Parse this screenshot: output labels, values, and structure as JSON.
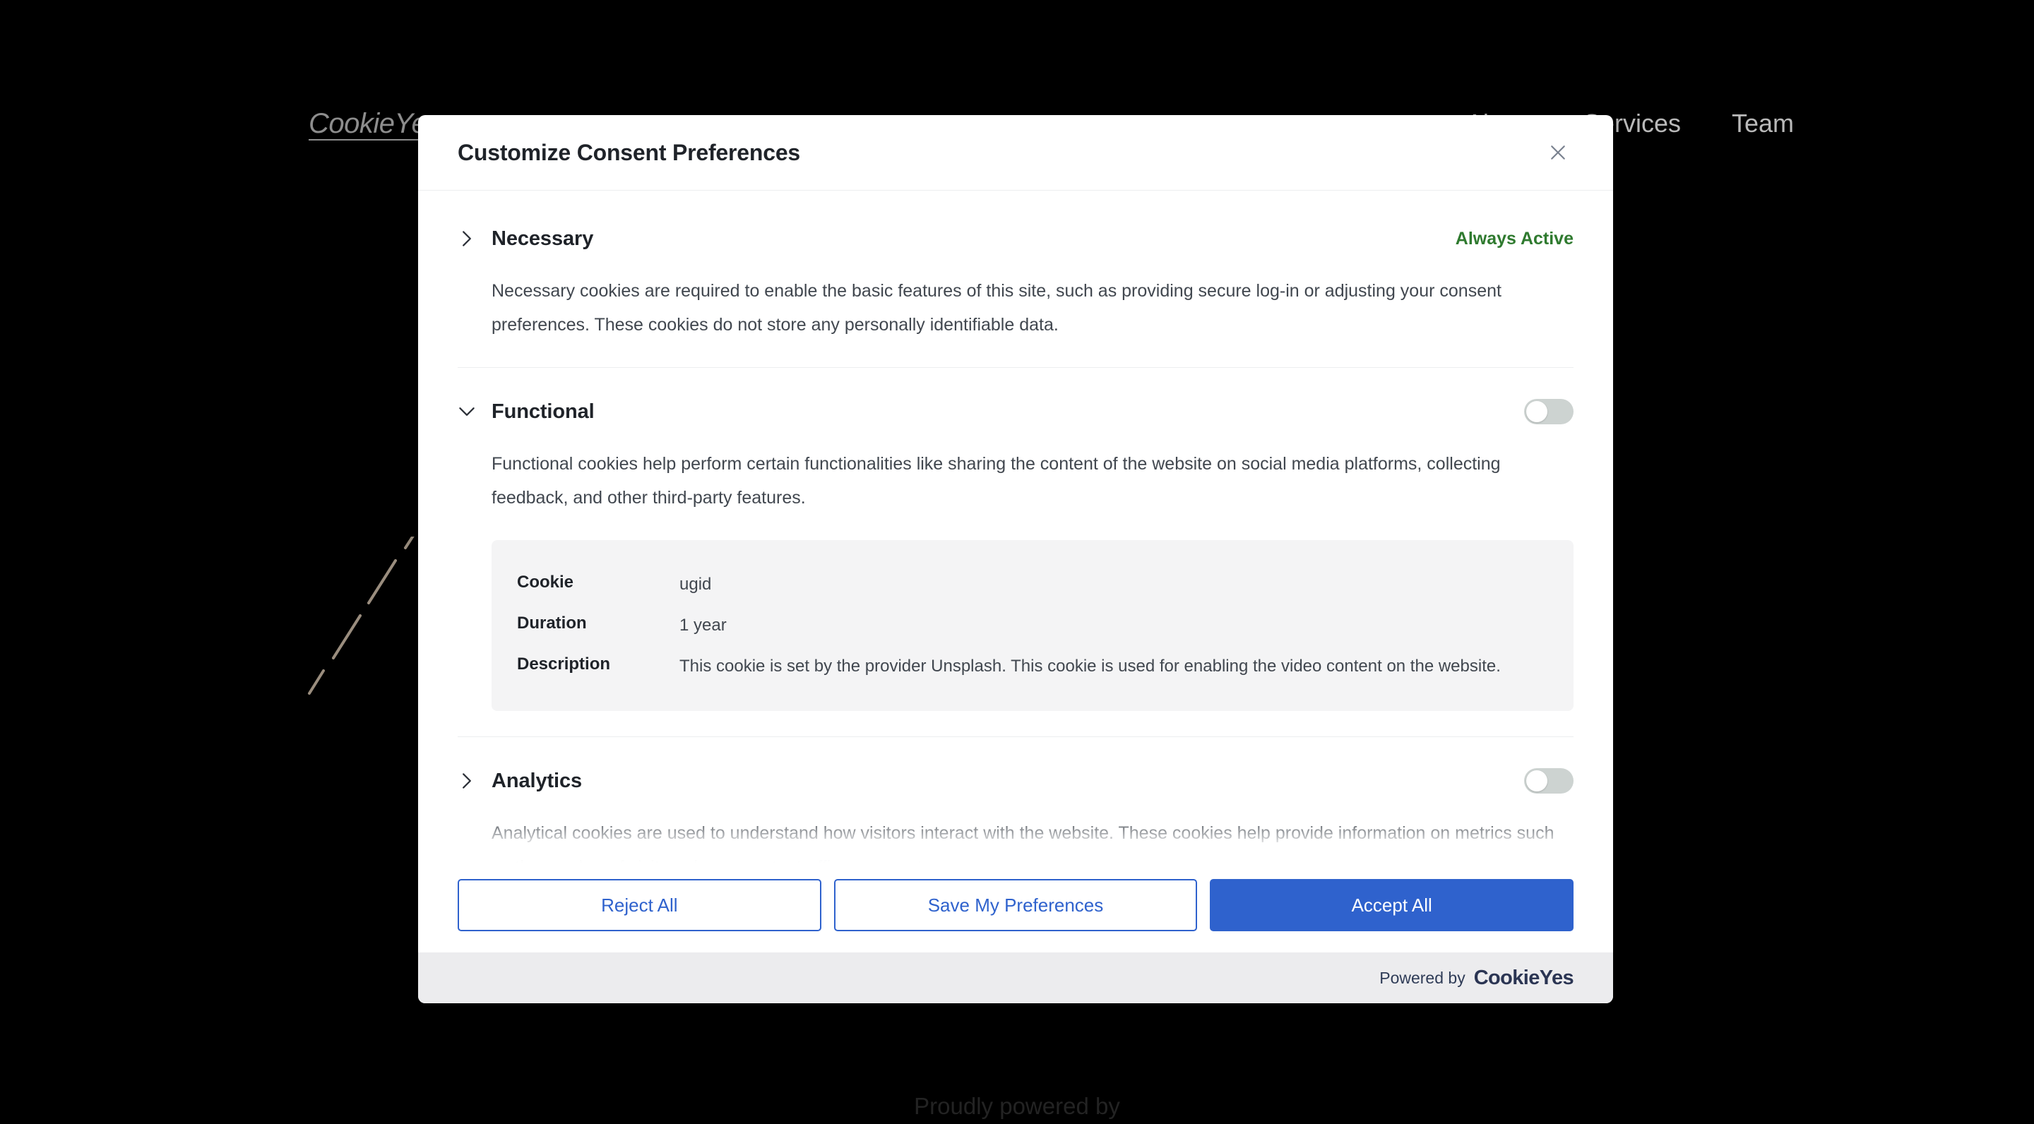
{
  "background": {
    "logo_text": "CookieYes",
    "nav_items": [
      "About",
      "Services",
      "Team"
    ],
    "footer_text": "Proudly powered by"
  },
  "modal": {
    "title": "Customize Consent Preferences",
    "close_icon": "close-icon",
    "categories": [
      {
        "id": "necessary",
        "name": "Necessary",
        "expanded": false,
        "chevron": "chevron-right-icon",
        "control_type": "always-active",
        "control_label": "Always Active",
        "description": "Necessary cookies are required to enable the basic features of this site, such as providing secure log-in or adjusting your consent preferences. These cookies do not store any personally identifiable data.",
        "cookies": []
      },
      {
        "id": "functional",
        "name": "Functional",
        "expanded": true,
        "chevron": "chevron-down-icon",
        "control_type": "toggle",
        "toggle_state": "off",
        "description": "Functional cookies help perform certain functionalities like sharing the content of the website on social media platforms, collecting feedback, and other third-party features.",
        "cookies": [
          {
            "rows": [
              {
                "key": "Cookie",
                "value": "ugid"
              },
              {
                "key": "Duration",
                "value": "1 year"
              },
              {
                "key": "Description",
                "value": "This cookie is set by the provider Unsplash. This cookie is used for enabling the video content on the website."
              }
            ]
          }
        ]
      },
      {
        "id": "analytics",
        "name": "Analytics",
        "expanded": false,
        "chevron": "chevron-right-icon",
        "control_type": "toggle",
        "toggle_state": "off",
        "description": "Analytical cookies are used to understand how visitors interact with the website. These cookies help provide information on metrics such as the number of visitors, bounce rate, traffic source, etc.",
        "cookies": []
      }
    ],
    "actions": {
      "reject_label": "Reject All",
      "save_label": "Save My Preferences",
      "accept_label": "Accept All"
    },
    "brandbar": {
      "powered_label": "Powered by",
      "brand_part1": "Cookie",
      "brand_part2": "Yes"
    }
  },
  "colors": {
    "accent_blue": "#2f62cd",
    "always_active_green": "#2f7a2f",
    "toggle_off": "#cdd3d1",
    "brand_navy": "#2b3553",
    "deco_tan": "#9a8d7e"
  }
}
